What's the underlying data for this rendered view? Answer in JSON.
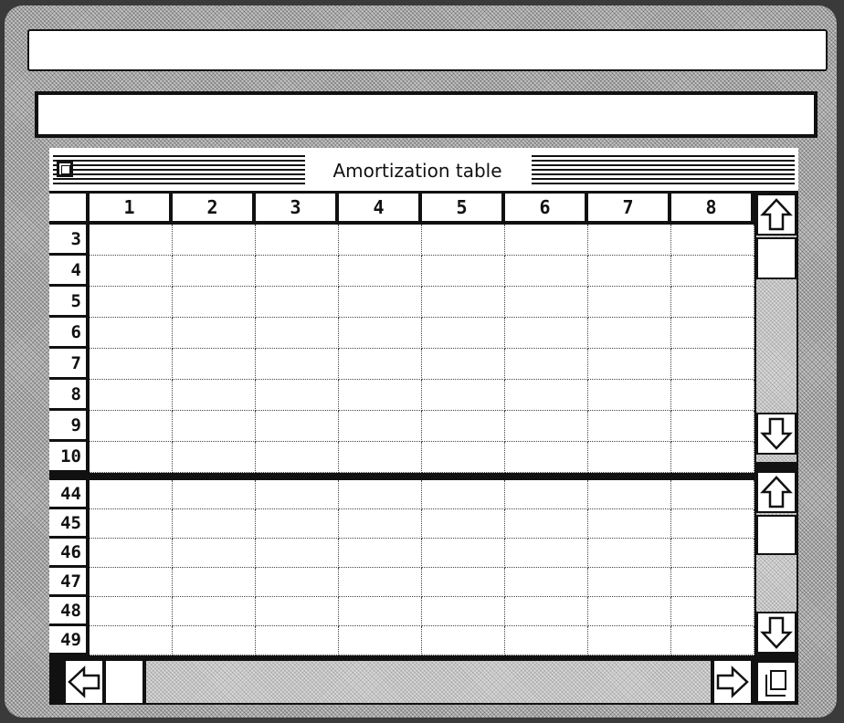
{
  "window": {
    "title": "Amortization table"
  },
  "columns": [
    "1",
    "2",
    "3",
    "4",
    "5",
    "6",
    "7",
    "8"
  ],
  "top_pane_rows": [
    "3",
    "4",
    "5",
    "6",
    "7",
    "8",
    "9",
    "10"
  ],
  "bottom_pane_rows": [
    "44",
    "45",
    "46",
    "47",
    "48",
    "49"
  ],
  "menu_bar": {
    "text": ""
  },
  "edit_line": {
    "value": ""
  },
  "icons": {
    "close": "close-box-icon",
    "scroll_up": "arrow-up-icon",
    "scroll_down": "arrow-down-icon",
    "scroll_left": "arrow-left-icon",
    "scroll_right": "arrow-right-icon",
    "grow": "grow-box-icon"
  },
  "colors": {
    "ink": "#111111",
    "paper": "#ffffff",
    "desktop": "#3a3a3a"
  }
}
